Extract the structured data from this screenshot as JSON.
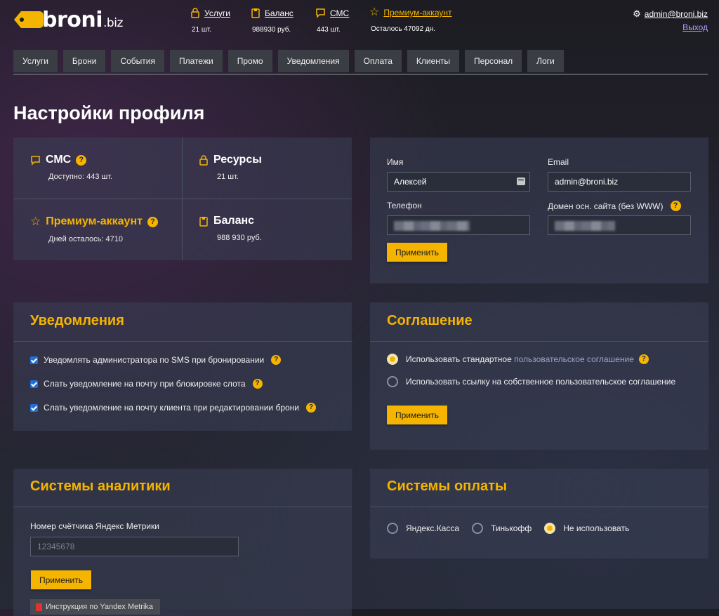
{
  "brand": {
    "name": "broni",
    "tld": ".biz"
  },
  "header": {
    "stats": [
      {
        "label": "Услуги",
        "value": "21 шт."
      },
      {
        "label": "Баланс",
        "value": "988930 руб."
      },
      {
        "label": "СМС",
        "value": "443 шт."
      },
      {
        "label": "Премиум-аккаунт",
        "value": "Осталось 47092 дн."
      }
    ],
    "user_email": "admin@broni.biz",
    "logout": "Выход"
  },
  "tabs": [
    "Услуги",
    "Брони",
    "События",
    "Платежи",
    "Промо",
    "Уведомления",
    "Оплата",
    "Клиенты",
    "Персонал",
    "Логи"
  ],
  "page_title": "Настройки профиля",
  "summary": {
    "sms_title": "СМС",
    "sms_sub": "Доступно: 443 шт.",
    "resources_title": "Ресурсы",
    "resources_sub": "21 шт.",
    "premium_title": "Премиум-аккаунт",
    "premium_sub": "Дней осталось: 4710",
    "balance_title": "Баланс",
    "balance_sub": "988 930 руб."
  },
  "profile": {
    "name_label": "Имя",
    "name_value": "Алексей",
    "email_label": "Email",
    "email_value": "admin@broni.biz",
    "phone_label": "Телефон",
    "domain_label": "Домен осн. сайта (без WWW)",
    "apply": "Применить"
  },
  "notifications": {
    "title": "Уведомления",
    "items": [
      "Уведомлять администратора по SMS при бронировании",
      "Слать уведомление на почту при блокировке слота",
      "Слать уведомление на почту клиента при редактировании брони"
    ]
  },
  "agreement": {
    "title": "Соглашение",
    "opt1_prefix": "Использовать стандартное",
    "opt1_link": "пользовательское соглашение",
    "opt2": "Использовать ссылку на собственное пользовательское соглашение",
    "apply": "Применить"
  },
  "analytics": {
    "title": "Системы аналитики",
    "counter_label": "Номер счётчика Яндекс Метрики",
    "counter_placeholder": "12345678",
    "apply": "Применить",
    "doc_button": "Инструкция по Yandex Metrika"
  },
  "payments": {
    "title": "Системы оплаты",
    "options": [
      "Яндекс.Касса",
      "Тинькофф",
      "Не использовать"
    ],
    "selected": "Не использовать"
  },
  "colors": {
    "accent": "#f5b400",
    "logout": "#b19cff",
    "checkbox": "#1f6fd6"
  }
}
